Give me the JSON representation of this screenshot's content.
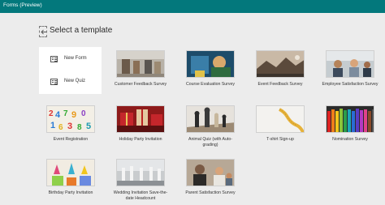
{
  "app": {
    "title": "Forms (Preview)"
  },
  "heading": "Select a template",
  "new_items": [
    {
      "label": "New Form"
    },
    {
      "label": "New Quiz"
    }
  ],
  "templates": [
    {
      "label": "Customer Feedback Survey"
    },
    {
      "label": "Course Evaluation Survey"
    },
    {
      "label": "Event Feedback Survey"
    },
    {
      "label": "Employee Satisfaction Survey"
    },
    {
      "label": "Event Registration"
    },
    {
      "label": "Holiday Party Invitation"
    },
    {
      "label": "Animal Quiz (with Auto-grading)"
    },
    {
      "label": "T-shirt Sign-up"
    },
    {
      "label": "Nomination Survey"
    },
    {
      "label": "Birthday Party Invitation"
    },
    {
      "label": "Wedding Invitation Save-the-date Headcount"
    },
    {
      "label": "Parent Satisfaction Survey"
    }
  ],
  "colors": {
    "topbar": "#03787c",
    "background": "#ececec"
  }
}
